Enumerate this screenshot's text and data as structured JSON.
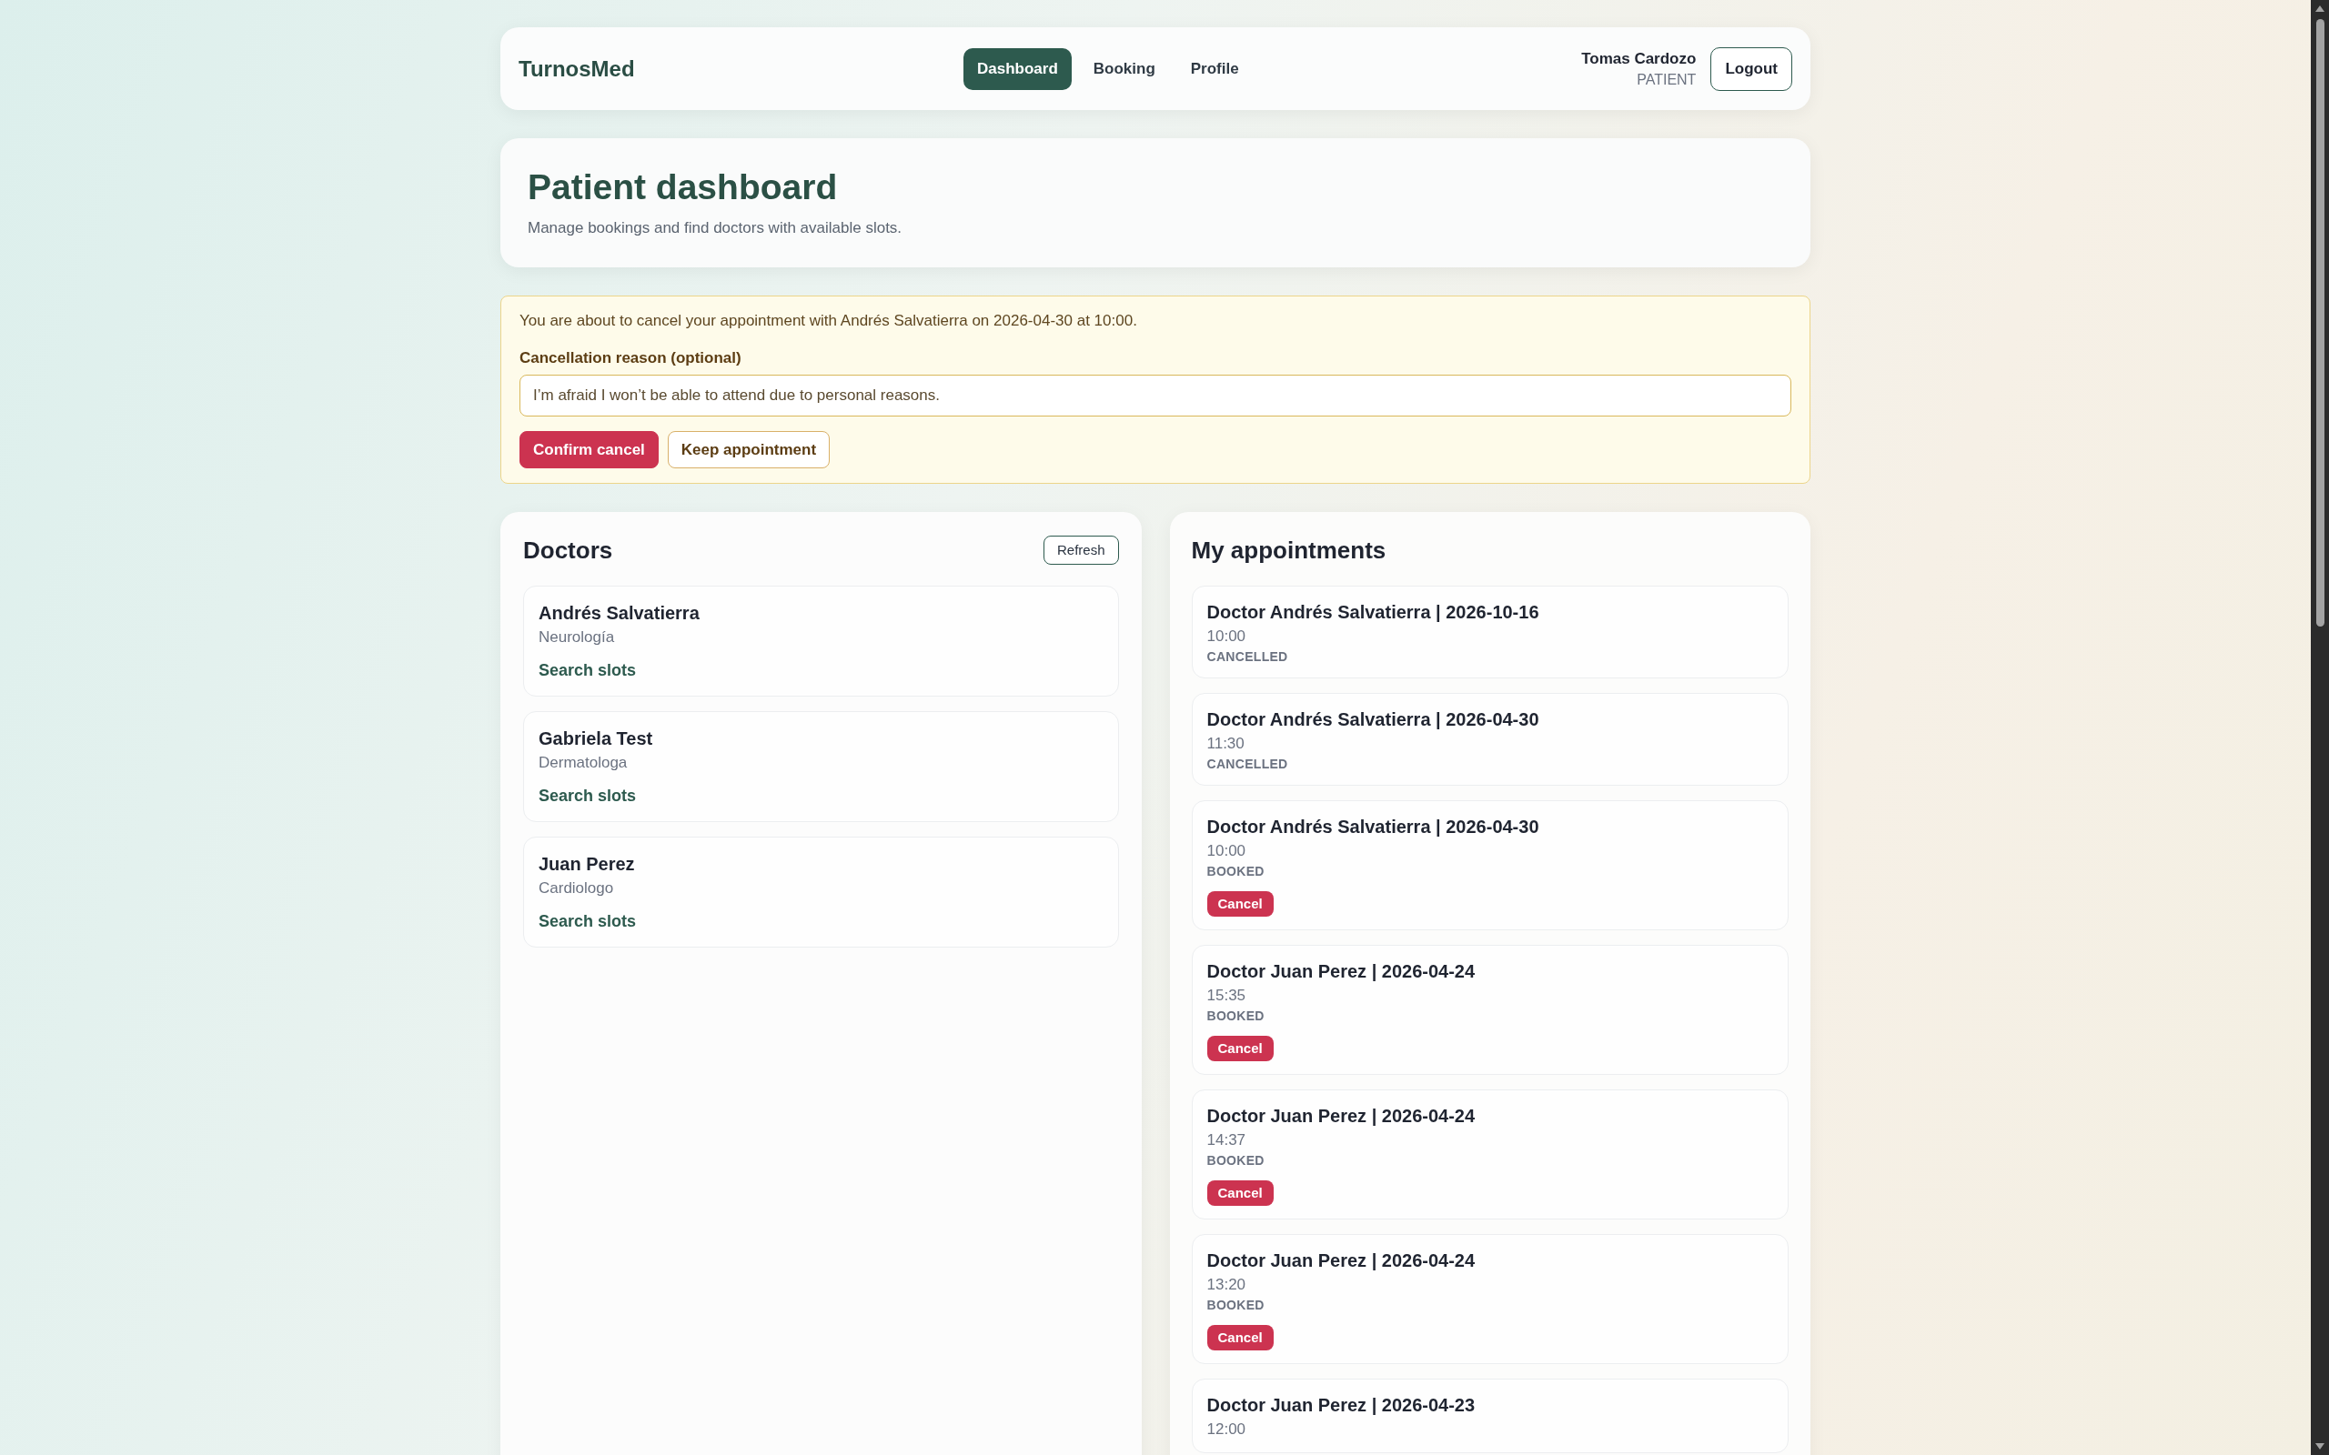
{
  "header": {
    "brand": "TurnosMed",
    "nav": [
      {
        "label": "Dashboard",
        "selected": true
      },
      {
        "label": "Booking",
        "selected": false
      },
      {
        "label": "Profile",
        "selected": false
      }
    ],
    "user": {
      "name": "Tomas Cardozo",
      "role": "PATIENT"
    },
    "logout_button": "Logout"
  },
  "page_header": {
    "title": "Patient dashboard",
    "subtitle": "Manage bookings and find doctors with available slots."
  },
  "cancel_dialog": {
    "message": "You are about to cancel your appointment with Andrés Salvatierra on 2026-04-30 at 10:00.",
    "reason_label": "Cancellation reason (optional)",
    "reason_value": "I’m afraid I won’t be able to attend due to personal reasons.",
    "buttons": [
      {
        "label": "Confirm cancel",
        "kind": "danger"
      },
      {
        "label": "Keep appointment",
        "kind": "secondary"
      }
    ]
  },
  "doctors": {
    "title": "Doctors",
    "refresh_button": "Refresh",
    "items": [
      {
        "name": "Andrés Salvatierra",
        "specialty": "Neurología",
        "action": "Search slots"
      },
      {
        "name": "Gabriela Test",
        "specialty": "Dermatologa",
        "action": "Search slots"
      },
      {
        "name": "Juan Perez",
        "specialty": "Cardiologo",
        "action": "Search slots"
      }
    ]
  },
  "appointments": {
    "title": "My appointments",
    "items": [
      {
        "title": "Doctor Andrés Salvatierra | 2026-10-16",
        "time": "10:00",
        "status": "CANCELLED"
      },
      {
        "title": "Doctor Andrés Salvatierra | 2026-04-30",
        "time": "11:30",
        "status": "CANCELLED"
      },
      {
        "title": "Doctor Andrés Salvatierra | 2026-04-30",
        "time": "10:00",
        "status": "BOOKED",
        "cancel_button": "Cancel"
      },
      {
        "title": "Doctor Juan Perez | 2026-04-24",
        "time": "15:35",
        "status": "BOOKED",
        "cancel_button": "Cancel"
      },
      {
        "title": "Doctor Juan Perez | 2026-04-24",
        "time": "14:37",
        "status": "BOOKED",
        "cancel_button": "Cancel"
      },
      {
        "title": "Doctor Juan Perez | 2026-04-24",
        "time": "13:20",
        "status": "BOOKED",
        "cancel_button": "Cancel"
      },
      {
        "title": "Doctor Juan Perez | 2026-04-23",
        "time": "12:00"
      }
    ]
  }
}
